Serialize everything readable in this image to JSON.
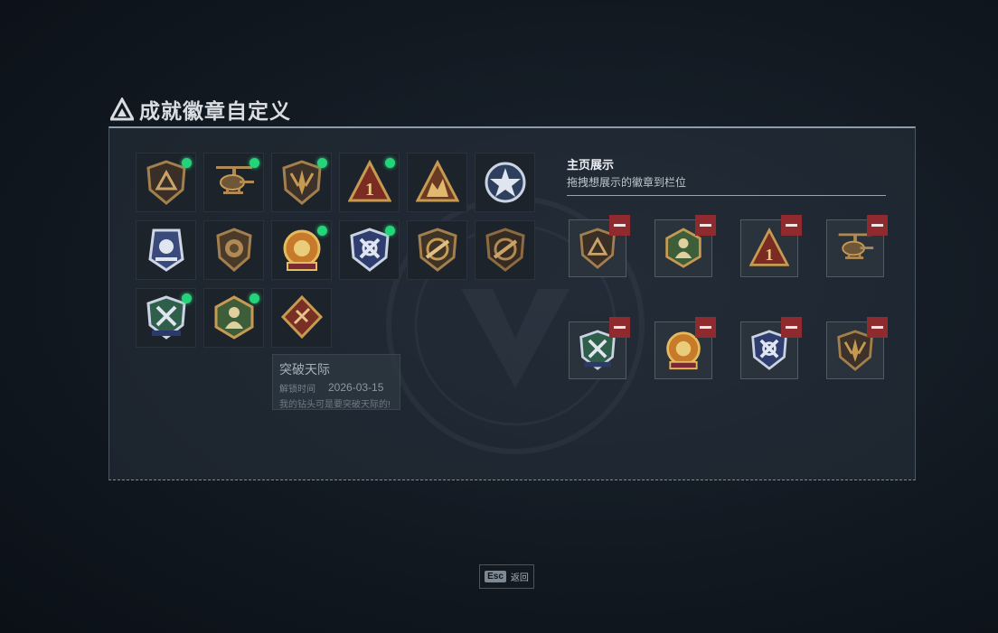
{
  "title": "成就徽章自定义",
  "colors": {
    "accent_green": "#25d47a",
    "remove_red": "#8f2a2f",
    "gold": "#c79a52"
  },
  "grid_badges": [
    {
      "icon": "shield-triangle-badge-icon",
      "unlocked": true
    },
    {
      "icon": "helicopter-badge-icon",
      "unlocked": true
    },
    {
      "icon": "dagger-shield-badge-icon",
      "unlocked": true
    },
    {
      "icon": "triangle-one-badge-icon",
      "unlocked": true
    },
    {
      "icon": "triangle-figure-badge-icon",
      "unlocked": false
    },
    {
      "icon": "star-circle-badge-icon",
      "unlocked": false
    },
    {
      "icon": "police-shield-badge-icon",
      "unlocked": false
    },
    {
      "icon": "lion-shield-badge-icon",
      "unlocked": false
    },
    {
      "icon": "gold-flower-badge-icon",
      "unlocked": true
    },
    {
      "icon": "blue-cross-badge-icon",
      "unlocked": true
    },
    {
      "icon": "rifle-shield-badge-icon",
      "unlocked": false
    },
    {
      "icon": "rifle-shield-dark-badge-icon",
      "unlocked": false
    },
    {
      "icon": "green-cross-badge-icon",
      "unlocked": true
    },
    {
      "icon": "green-hex-figure-badge-icon",
      "unlocked": true
    },
    {
      "icon": "red-diamond-badge-icon",
      "unlocked": false
    }
  ],
  "tooltip": {
    "name": "突破天际",
    "time_label": "解锁时间",
    "date": "2026-03-15",
    "desc": "我的钻头可是要突破天际的!"
  },
  "display": {
    "title": "主页展示",
    "subtitle": "拖拽想展示的徽章到栏位",
    "slots": [
      {
        "icon": "shield-triangle-badge-icon"
      },
      {
        "icon": "green-hex-figure-badge-icon"
      },
      {
        "icon": "triangle-one-badge-icon"
      },
      {
        "icon": "helicopter-badge-icon"
      },
      {
        "icon": "green-cross-badge-icon"
      },
      {
        "icon": "gold-flower-badge-icon"
      },
      {
        "icon": "blue-cross-badge-icon"
      },
      {
        "icon": "dagger-shield-badge-icon"
      }
    ]
  },
  "footer": {
    "esc_key": "Esc",
    "back_label": "返回"
  }
}
